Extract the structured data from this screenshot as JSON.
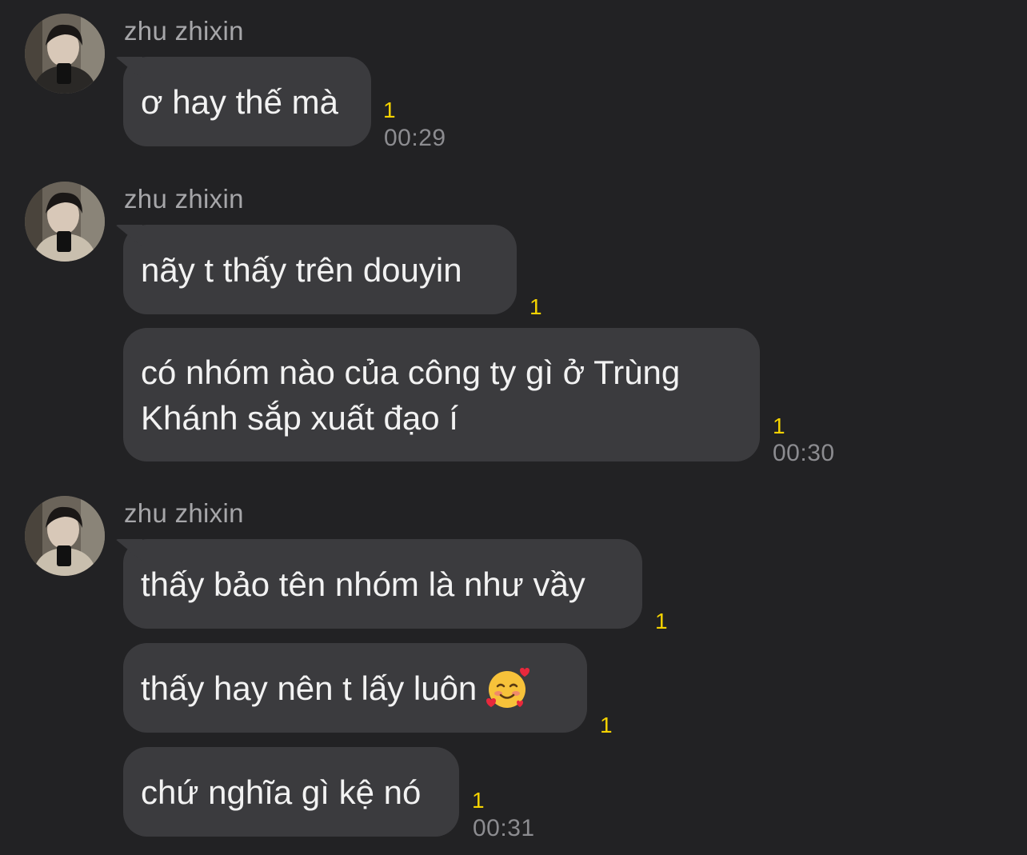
{
  "groups": [
    {
      "sender": "zhu zhixin",
      "messages": [
        {
          "text": "ơ hay thế mà",
          "unread": "1",
          "time": "00:29"
        }
      ]
    },
    {
      "sender": "zhu zhixin",
      "messages": [
        {
          "text": "nãy t thấy trên douyin",
          "unread": "1"
        },
        {
          "line1": "có nhóm nào của công ty gì ở Trùng",
          "line2": "Khánh sắp xuất đạo í",
          "unread": "1",
          "time": "00:30"
        }
      ]
    },
    {
      "sender": "zhu zhixin",
      "messages": [
        {
          "text": "thấy bảo tên nhóm là như vầy",
          "unread": "1"
        },
        {
          "text": "thấy hay nên t lấy luôn",
          "emoji": "smiling-face-with-hearts-emoji",
          "unread": "1"
        },
        {
          "text": "chứ nghĩa gì kệ nó",
          "unread": "1",
          "time": "00:31"
        }
      ]
    }
  ],
  "colors": {
    "background": "#222224",
    "bubble": "#3b3b3e",
    "unread": "#f4d200",
    "time": "#8c8c90",
    "sender": "#a6a6a9"
  }
}
